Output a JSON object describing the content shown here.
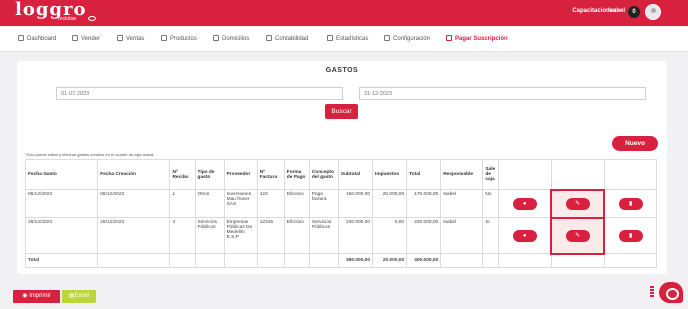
{
  "brand": {
    "logo": "loggro",
    "sub": "restobar"
  },
  "topbar": {
    "company": "Capacitaciones -",
    "user": "Isabel",
    "badge_count": "0"
  },
  "nav": [
    {
      "label": "Dashboard",
      "icon": "grid-icon"
    },
    {
      "label": "Vender",
      "icon": "cart-icon"
    },
    {
      "label": "Ventas",
      "icon": "tag-icon"
    },
    {
      "label": "Productos",
      "icon": "box-icon"
    },
    {
      "label": "Domicilios",
      "icon": "bike-icon"
    },
    {
      "label": "Contabilidad",
      "icon": "calculator-icon"
    },
    {
      "label": "Estadísticas",
      "icon": "chart-icon"
    },
    {
      "label": "Configuración",
      "icon": "gear-icon"
    },
    {
      "label": "Pagar Suscripción",
      "icon": "card-icon"
    }
  ],
  "page": {
    "title": "GASTOS",
    "date_from": "01-07-2023",
    "date_to": "31-12-2023",
    "search_label": "Buscar",
    "new_label": "Nuevo",
    "note": "*Solo puede editar y eliminar gastos creados en el cuadre de caja actual."
  },
  "table": {
    "headers": [
      "Fecha Gasto",
      "Fecha Creación",
      "Nº Recibo",
      "Tipo de gasto",
      "Proveedor",
      "Nº Factura",
      "Forma de Pago",
      "Concepto del gasto",
      "Subtotal",
      "Impuestos",
      "Total",
      "Responsable",
      "Sale de caja",
      "",
      "",
      ""
    ],
    "rows": [
      [
        "06/12/2023",
        "06/12/2023",
        "1",
        "Otros",
        "Inversiones Mau fruver SAS",
        "123",
        "Efectivo",
        "Pago factura",
        "150.000,00",
        "20.000,00",
        "170.000,00",
        "Isabel",
        "No"
      ],
      [
        "28/12/2023",
        "28/12/2023",
        "3",
        "Servicios Públicos",
        "Empresas Públicas De Medellín E.S.P",
        "12345",
        "Efectivo",
        "Servicios Públicos",
        "230.000,00",
        "0,00",
        "230.000,00",
        "Isabel",
        "Si"
      ]
    ],
    "total_label": "Total",
    "totals": {
      "subtotal": "380.000,00",
      "impuestos": "20.000,00",
      "total": "400.000,00"
    }
  },
  "footer": {
    "print_label": "Imprimir",
    "excel_label": "Excel"
  },
  "colors": {
    "brand_red": "#d8213f",
    "excel_green": "#bcd63a"
  }
}
